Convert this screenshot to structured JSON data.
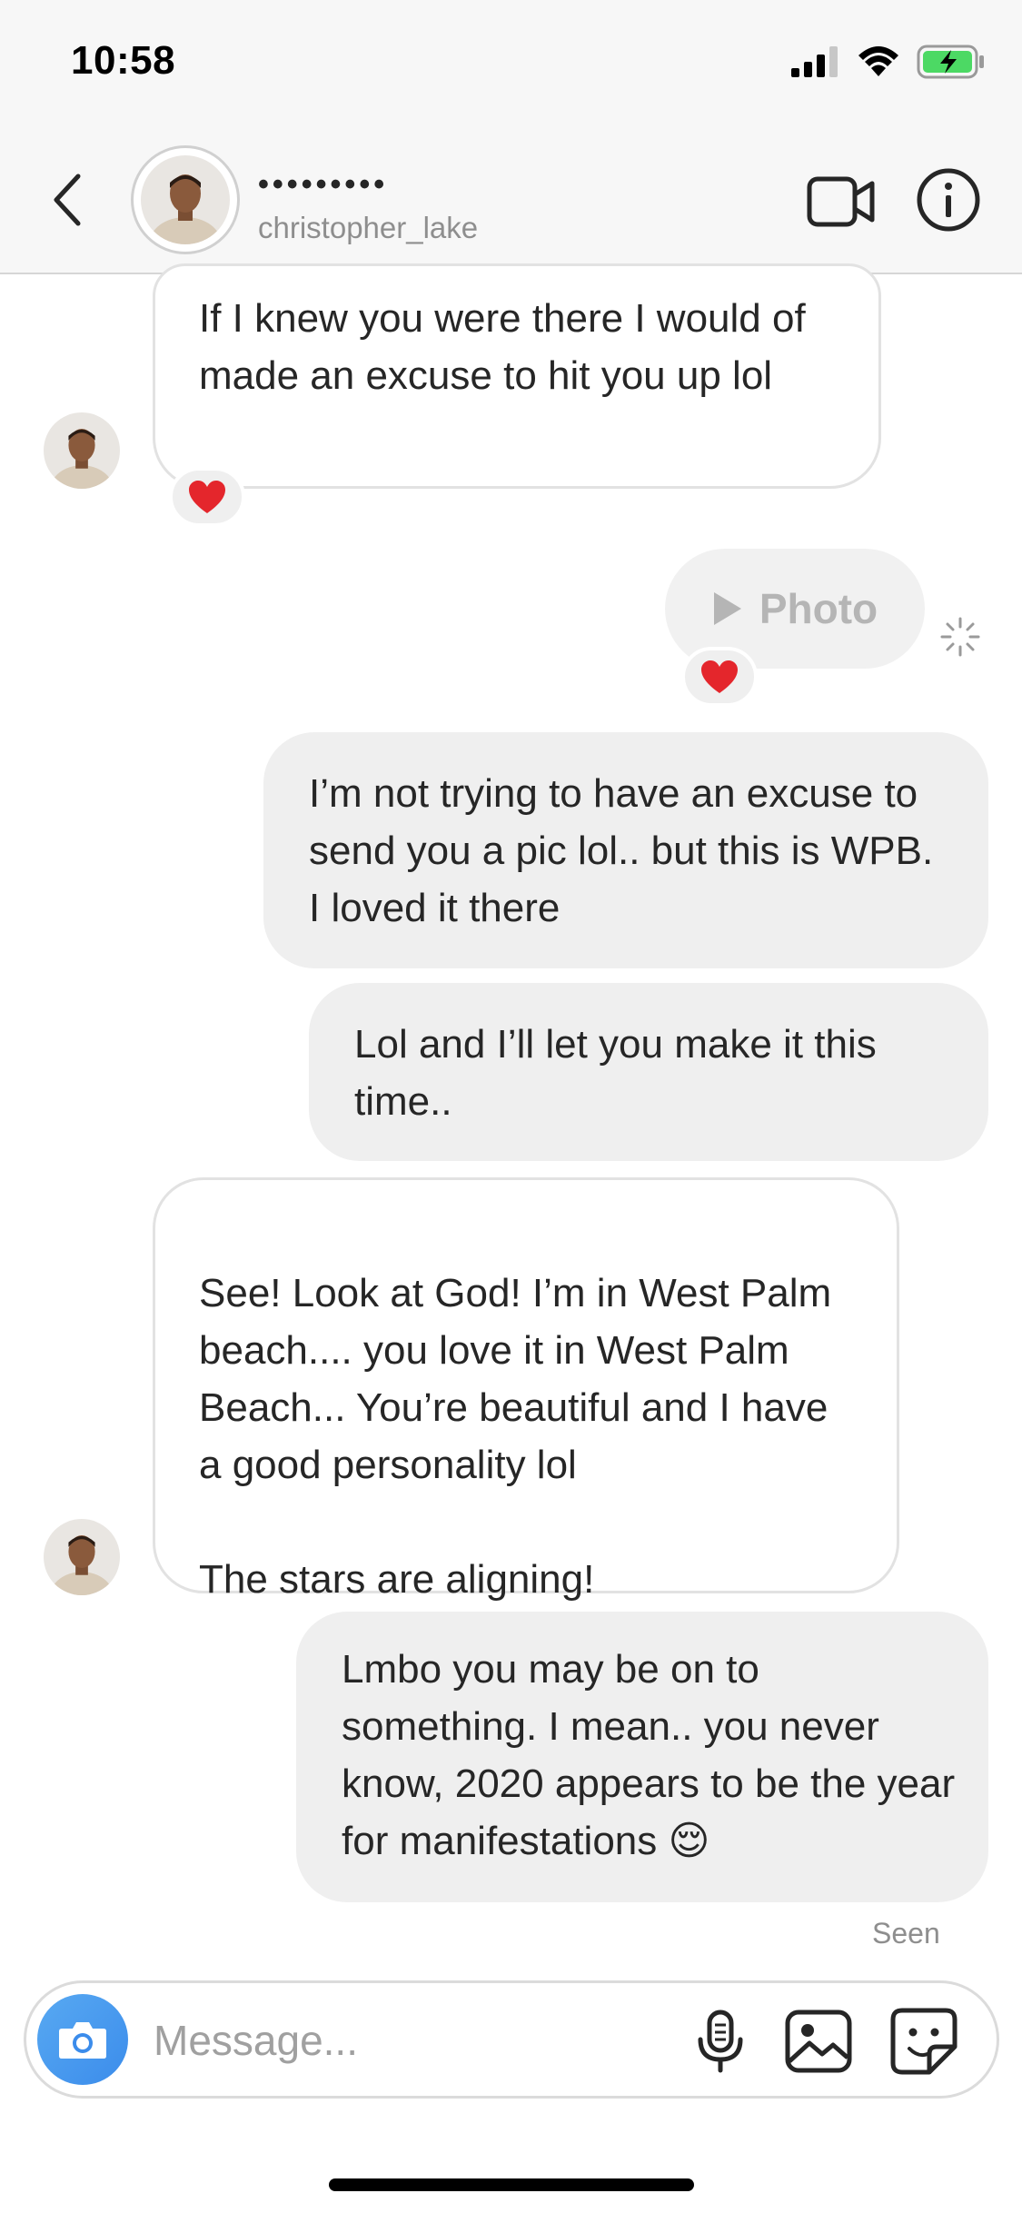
{
  "status_bar": {
    "time": "10:58",
    "signal_icon": "cellular-signal-icon",
    "wifi_icon": "wifi-icon",
    "battery_icon": "battery-charging-icon",
    "battery_color": "#4cd964"
  },
  "header": {
    "display_name": "•••••••••",
    "username": "christopher_lake",
    "back_icon": "chevron-left-icon",
    "video_icon": "video-call-icon",
    "info_icon": "info-icon"
  },
  "messages": [
    {
      "side": "in",
      "text": "If I knew you were there I would of made an excuse to hit you up lol",
      "reaction": "❤️"
    },
    {
      "side": "out",
      "type": "photo",
      "label": "Photo",
      "reaction": "❤️"
    },
    {
      "side": "out",
      "text": "I’m not trying to have an excuse to send you a pic lol.. but this is WPB. I loved it there"
    },
    {
      "side": "out",
      "text": "Lol and I’ll let you make it this time.."
    },
    {
      "side": "in",
      "text": "See! Look at God! I’m in West Palm beach.... you love it in West Palm Beach... You’re beautiful and I have a good personality lol\n\nThe stars are aligning!"
    },
    {
      "side": "out",
      "text": "Lmbo you may be on to something. I mean.. you never know, 2020 appears to be the year for manifestations 😌"
    }
  ],
  "seen_label": "Seen",
  "composer": {
    "placeholder": "Message...",
    "camera_icon": "camera-icon",
    "mic_icon": "microphone-icon",
    "gallery_icon": "gallery-icon",
    "sticker_icon": "sticker-icon"
  },
  "colors": {
    "incoming_bg": "#ffffff",
    "outgoing_bg": "#efefef",
    "camera_blue": "#3b8ceb"
  }
}
